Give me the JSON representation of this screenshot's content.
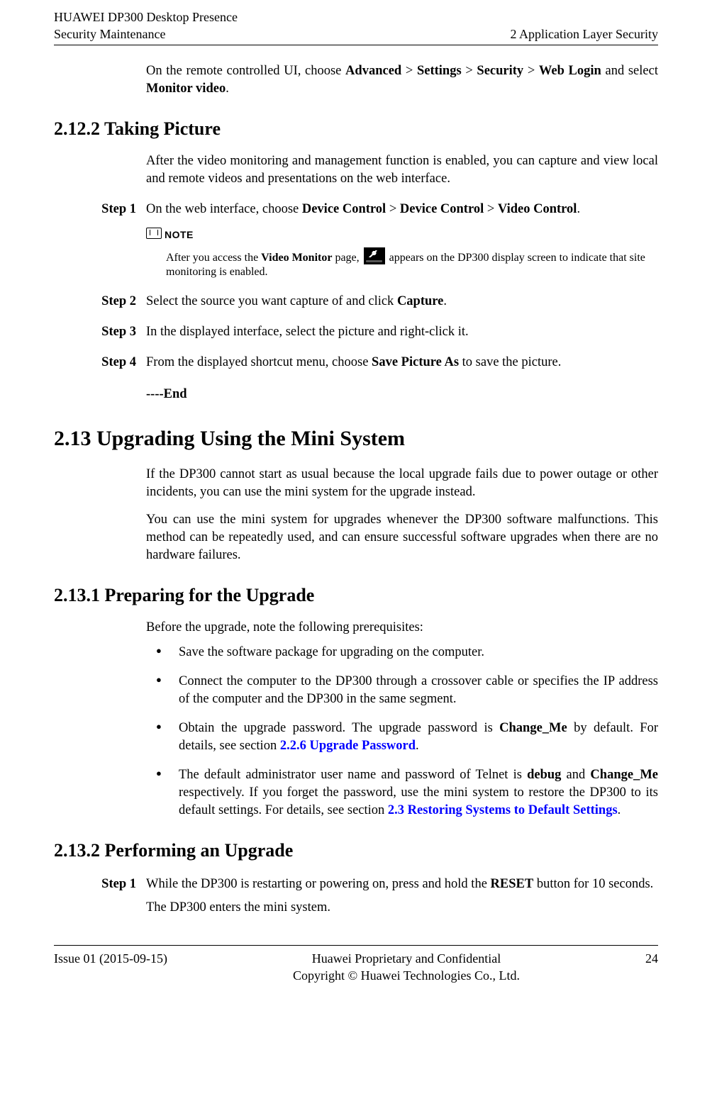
{
  "header": {
    "left1": "HUAWEI DP300 Desktop Presence",
    "left2": "Security Maintenance",
    "right": "2 Application Layer Security"
  },
  "intro": {
    "part1": "On the remote controlled UI, choose ",
    "nav1": "Advanced",
    "sep": " > ",
    "nav2": "Settings",
    "nav3": "Security",
    "nav4": "Web Login",
    "part2": " and select",
    "part3": "Monitor video",
    "period": "."
  },
  "s2122": {
    "heading": "2.12.2 Taking Picture",
    "p1": "After the video monitoring and management function is enabled, you can capture and view local and remote videos and presentations on the web interface.",
    "step1_label": "Step 1",
    "step1_a": "On the web interface, choose ",
    "step1_b1": "Device Control",
    "step1_b2": "Device Control",
    "step1_b3": "Video Control",
    "step1_end": ".",
    "note_label": "NOTE",
    "note_a": "After you access the ",
    "note_b": "Video Monitor",
    "note_c": " page, ",
    "note_d": " appears on the DP300 display screen to indicate that site monitoring is enabled.",
    "step2_label": "Step 2",
    "step2_a": "Select the source you want capture of and click ",
    "step2_b": "Capture",
    "step2_end": ".",
    "step3_label": "Step 3",
    "step3": "In the displayed interface, select the picture and right-click it.",
    "step4_label": "Step 4",
    "step4_a": "From the displayed shortcut menu, choose ",
    "step4_b": "Save Picture As",
    "step4_c": " to save the picture.",
    "end": "----End"
  },
  "s213": {
    "heading": "2.13 Upgrading Using the Mini System",
    "p1": "If the DP300 cannot start as usual because the local upgrade fails due to power outage or other incidents, you can use the mini system for the upgrade instead.",
    "p2": "You can use the mini system for upgrades whenever the DP300 software malfunctions. This method can be repeatedly used, and can ensure successful software upgrades when there are no hardware failures."
  },
  "s2131": {
    "heading": "2.13.1 Preparing for the Upgrade",
    "p1": "Before the upgrade, note the following prerequisites:",
    "b1": "Save the software package for upgrading on the computer.",
    "b2": "Connect the computer to the DP300 through a crossover cable or specifies the IP address of the computer and the DP300 in the same segment.",
    "b3_a": "Obtain the upgrade password. The upgrade password is ",
    "b3_b": "Change_Me",
    "b3_c": " by default. For details, see section ",
    "b3_link": "2.2.6 Upgrade Password",
    "b3_end": ".",
    "b4_a": "The default administrator user name and password of Telnet is ",
    "b4_b": "debug",
    "b4_and": " and ",
    "b4_c": "Change_Me",
    "b4_d": " respectively. If you forget the password, use the mini system to restore the DP300 to its default settings. For details, see section ",
    "b4_link": "2.3 Restoring Systems to Default Settings",
    "b4_end": "."
  },
  "s2132": {
    "heading": "2.13.2 Performing an Upgrade",
    "step1_label": "Step 1",
    "step1_a": "While the DP300 is restarting or powering on, press and hold the ",
    "step1_b": "RESET",
    "step1_c": " button for 10 seconds.",
    "step1_p2": "The DP300 enters the mini system."
  },
  "footer": {
    "left": "Issue 01 (2015-09-15)",
    "center1": "Huawei Proprietary and Confidential",
    "center2": "Copyright © Huawei Technologies Co., Ltd.",
    "right": "24"
  }
}
